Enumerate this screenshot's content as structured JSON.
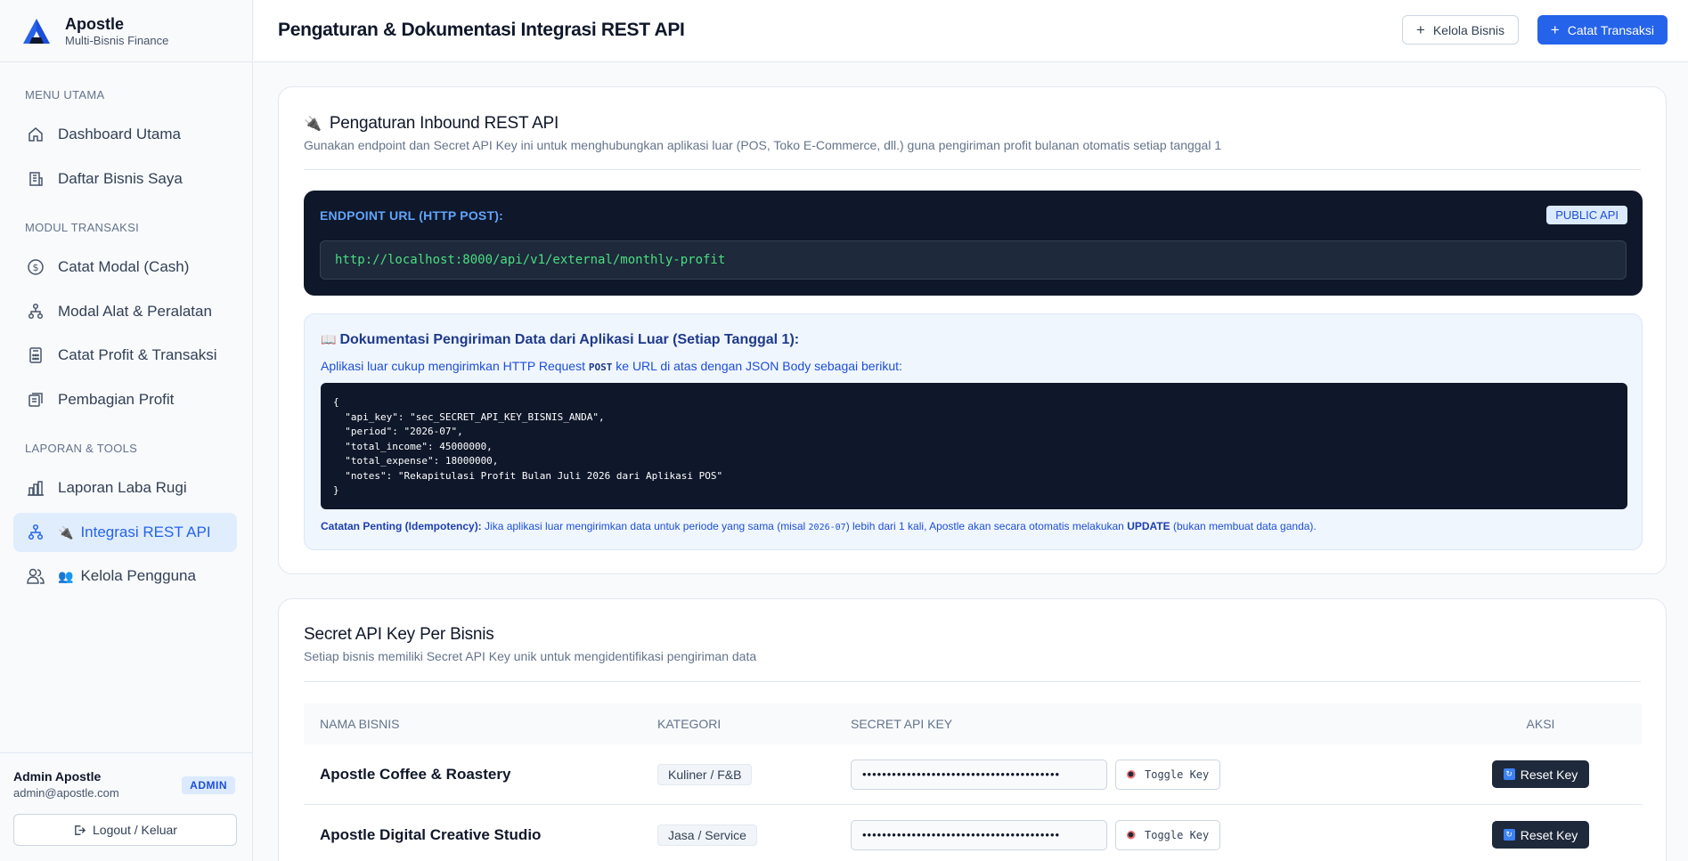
{
  "brand": {
    "name": "Apostle",
    "subtitle": "Multi-Bisnis Finance"
  },
  "sidebar": {
    "sections": [
      {
        "title": "MENU UTAMA"
      },
      {
        "title": "MODUL TRANSAKSI"
      },
      {
        "title": "LAPORAN & TOOLS"
      }
    ],
    "items": [
      {
        "label": "Dashboard Utama",
        "icon": "home-icon"
      },
      {
        "label": "Daftar Bisnis Saya",
        "icon": "building-icon"
      },
      {
        "label": "Catat Modal (Cash)",
        "icon": "dollar-circle-icon"
      },
      {
        "label": "Modal Alat & Peralatan",
        "icon": "workflow-icon"
      },
      {
        "label": "Catat Profit & Transaksi",
        "icon": "calculator-icon"
      },
      {
        "label": "Pembagian Profit",
        "icon": "receipt-icon"
      },
      {
        "label": "Laporan Laba Rugi",
        "icon": "bar-chart-icon"
      },
      {
        "label": "Integrasi REST API",
        "icon": "workflow-icon",
        "emoji": "🔌",
        "active": true
      },
      {
        "label": "Kelola Pengguna",
        "icon": "users-icon",
        "emoji": "👥"
      }
    ],
    "user": {
      "name": "Admin Apostle",
      "email": "admin@apostle.com",
      "role": "ADMIN"
    },
    "logout_label": "Logout / Keluar"
  },
  "header": {
    "title": "Pengaturan & Dokumentasi Integrasi REST API",
    "btn_business": "Kelola Bisnis",
    "btn_transaction": "Catat Transaksi"
  },
  "inbound": {
    "emoji": "🔌",
    "title": "Pengaturan Inbound REST API",
    "subtitle": "Gunakan endpoint dan Secret API Key ini untuk menghubungkan aplikasi luar (POS, Toko E-Commerce, dll.) guna pengiriman profit bulanan otomatis setiap tanggal 1",
    "endpoint_label": "ENDPOINT URL (HTTP POST):",
    "public_badge": "PUBLIC API",
    "endpoint_url": "http://localhost:8000/api/v1/external/monthly-profit",
    "doc_emoji": "📖",
    "doc_title": "Dokumentasi Pengiriman Data dari Aplikasi Luar (Setiap Tanggal 1):",
    "doc_desc_pre": "Aplikasi luar cukup mengirimkan HTTP Request ",
    "doc_desc_method": "POST",
    "doc_desc_post": " ke URL di atas dengan JSON Body sebagai berikut:",
    "code": "{\n  \"api_key\": \"sec_SECRET_API_KEY_BISNIS_ANDA\",\n  \"period\": \"2026-07\",\n  \"total_income\": 45000000,\n  \"total_expense\": 18000000,\n  \"notes\": \"Rekapitulasi Profit Bulan Juli 2026 dari Aplikasi POS\"\n}",
    "note_label": "Catatan Penting (Idempotency):",
    "note_pre": " Jika aplikasi luar mengirimkan data untuk periode yang sama (misal ",
    "note_code": "2026-07",
    "note_mid": ") lebih dari 1 kali, Apostle akan secara otomatis melakukan ",
    "note_bold": "UPDATE",
    "note_post": " (bukan membuat data ganda)."
  },
  "keys": {
    "title": "Secret API Key Per Bisnis",
    "subtitle": "Setiap bisnis memiliki Secret API Key unik untuk mengidentifikasi pengiriman data",
    "columns": [
      "NAMA BISNIS",
      "KATEGORI",
      "SECRET API KEY",
      "AKSI"
    ],
    "rows": [
      {
        "name": "Apostle Coffee & Roastery",
        "category": "Kuliner / F&B",
        "key_masked": "••••••••••••••••••••••••••••••••••••••••",
        "toggle_label": "Toggle Key",
        "reset_label": "Reset Key"
      },
      {
        "name": "Apostle Digital Creative Studio",
        "category": "Jasa / Service",
        "key_masked": "••••••••••••••••••••••••••••••••••••••••",
        "toggle_label": "Toggle Key",
        "reset_label": "Reset Key"
      }
    ]
  },
  "colors": {
    "primary": "#2563eb",
    "dark": "#0f172a",
    "accent_green": "#4ade80"
  }
}
